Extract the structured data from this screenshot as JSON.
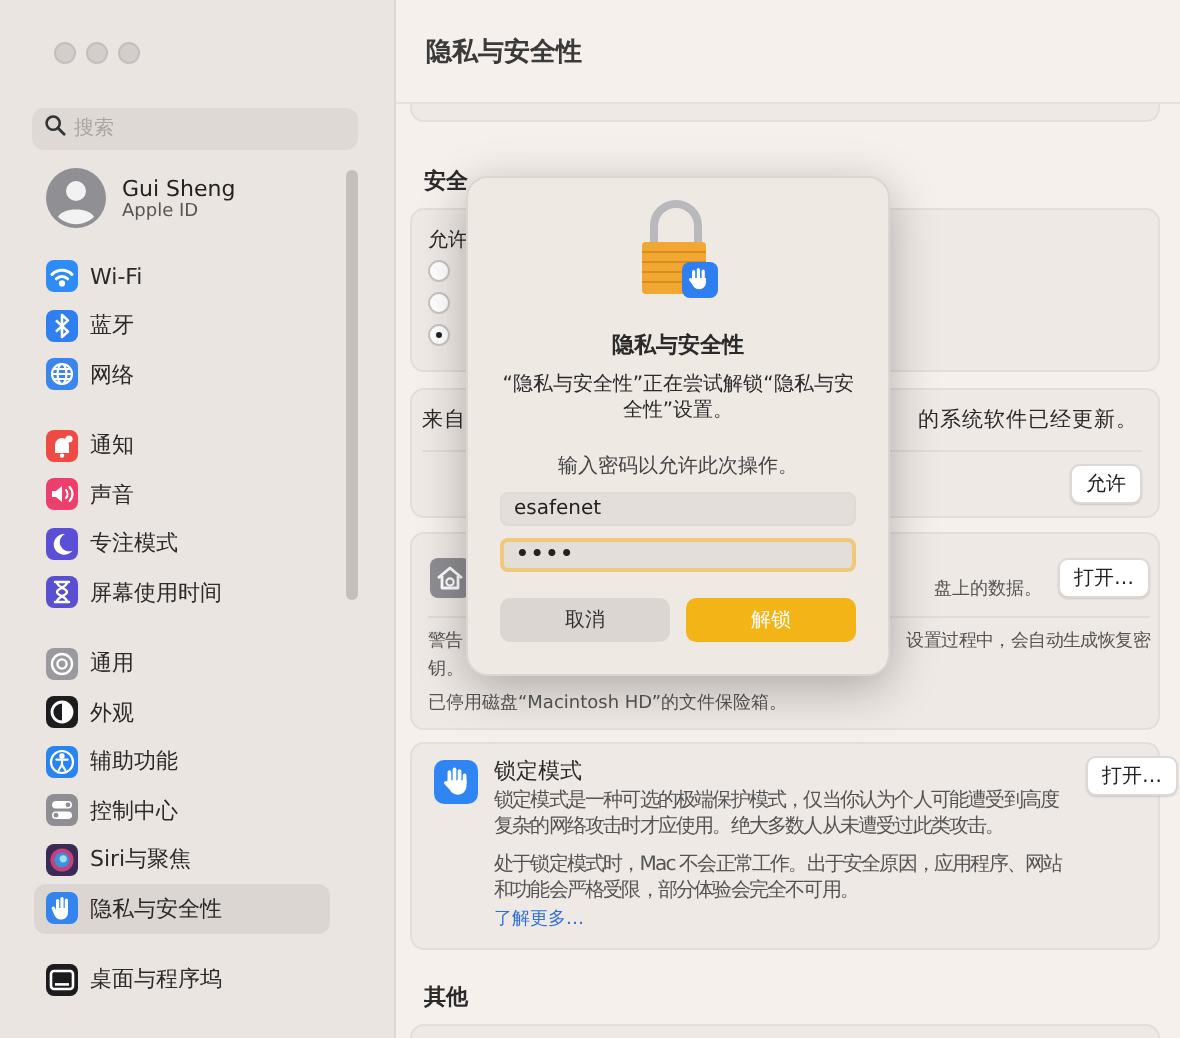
{
  "window": {
    "title": "隐私与安全性"
  },
  "sidebar": {
    "search": {
      "placeholder": "搜索"
    },
    "account": {
      "name": "Gui Sheng",
      "subtitle": "Apple ID"
    },
    "groups": [
      [
        {
          "label": "Wi-Fi",
          "color": "#2f8cf5",
          "selected": false
        },
        {
          "label": "蓝牙",
          "color": "#2f7ff0",
          "selected": false
        },
        {
          "label": "网络",
          "color": "#3a86ee",
          "selected": false
        }
      ],
      [
        {
          "label": "通知",
          "color": "#ee4b45",
          "selected": false
        },
        {
          "label": "声音",
          "color": "#ec3f6d",
          "selected": false
        },
        {
          "label": "专注模式",
          "color": "#5b4fd6",
          "selected": false
        },
        {
          "label": "屏幕使用时间",
          "color": "#5a4fd0",
          "selected": false
        }
      ],
      [
        {
          "label": "通用",
          "color": "#9a9a9e",
          "selected": false
        },
        {
          "label": "外观",
          "color": "#1c1c1e",
          "selected": false
        },
        {
          "label": "辅助功能",
          "color": "#2a84f0",
          "selected": false
        },
        {
          "label": "控制中心",
          "color": "#8e8e93",
          "selected": false
        },
        {
          "label": "Siri与聚焦",
          "color": "#3b2a55",
          "selected": false
        },
        {
          "label": "隐私与安全性",
          "color": "#3484f0",
          "selected": true
        }
      ],
      [
        {
          "label": "桌面与程序坞",
          "color": "#1c1c1e",
          "selected": false
        }
      ]
    ]
  },
  "security": {
    "title": "安全",
    "allow_label": "允许",
    "options": [
      {
        "selected": false
      },
      {
        "selected": false
      },
      {
        "selected": true
      }
    ]
  },
  "system_software": {
    "text_left": "来自",
    "text_right": "的系统软件已经更新。",
    "button": "允许"
  },
  "filevault": {
    "text_right": "盘上的数据。",
    "button": "打开…",
    "warning_left": "警告",
    "warning_right": "设置过程中，会自动生成恢复密",
    "warning_left_2": "钥。",
    "status": "已停用磁盘“Macintosh HD”的文件保险箱。"
  },
  "lockdown": {
    "title": "锁定模式",
    "button": "打开…",
    "paragraphs": [
      "锁定模式是一种可选的极端保护模式，仅当你认为个人可能遭受到高度复杂的网络攻击时才应使用。绝大多数人从未遭受过此类攻击。",
      "处于锁定模式时，Mac 不会正常工作。出于安全原因，应用程序、网站和功能会严格受限，部分体验会完全不可用。"
    ],
    "link": "了解更多…"
  },
  "other": {
    "title": "其他"
  },
  "dialog": {
    "title": "隐私与安全性",
    "message": "“隐私与安全性”正在尝试解锁“隐私与安全性”设置。",
    "prompt": "输入密码以允许此次操作。",
    "fields": [
      {
        "kind": "text",
        "value": "esafenet",
        "focused": false
      },
      {
        "kind": "password",
        "value": "••••",
        "focused": true
      }
    ],
    "buttons": [
      {
        "label": "取消",
        "kind": "secondary"
      },
      {
        "label": "解锁",
        "kind": "primary"
      }
    ]
  }
}
